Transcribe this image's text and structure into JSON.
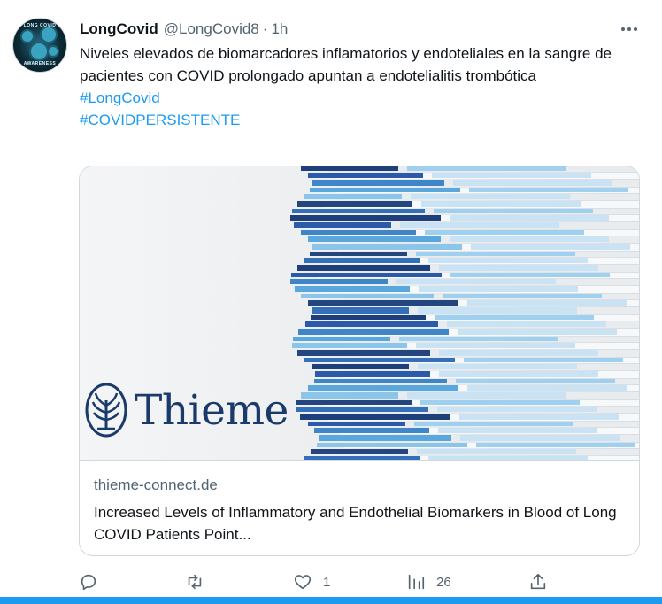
{
  "tweet": {
    "display_name": "LongCovid",
    "handle": "@LongCovid8",
    "separator": "·",
    "time": "1h",
    "body": "Niveles elevados de biomarcadores inflamatorios y endoteliales en la sangre de pacientes con COVID prolongado apuntan a endotelialitis trombótica",
    "hashtags": [
      "#LongCovid",
      "#COVIDPERSISTENTE"
    ],
    "avatar_text_top": "LONG COVID",
    "avatar_text_bottom": "AWARENESS"
  },
  "card": {
    "logo_text": "Thieme",
    "domain": "thieme-connect.de",
    "title": "Increased Levels of Inflammatory and Endothelial Biomarkers in Blood of Long COVID Patients Point..."
  },
  "actions": {
    "reply": {
      "icon": "reply-icon",
      "count": ""
    },
    "retweet": {
      "icon": "retweet-icon",
      "count": ""
    },
    "like": {
      "icon": "heart-icon",
      "count": "1"
    },
    "views": {
      "icon": "views-icon",
      "count": "26"
    },
    "share": {
      "icon": "share-icon",
      "count": ""
    }
  },
  "colors": {
    "accent": "#1d9bf0",
    "secondary_text": "#536471",
    "border": "#cfd9de",
    "logo": "#1a3a6b"
  }
}
